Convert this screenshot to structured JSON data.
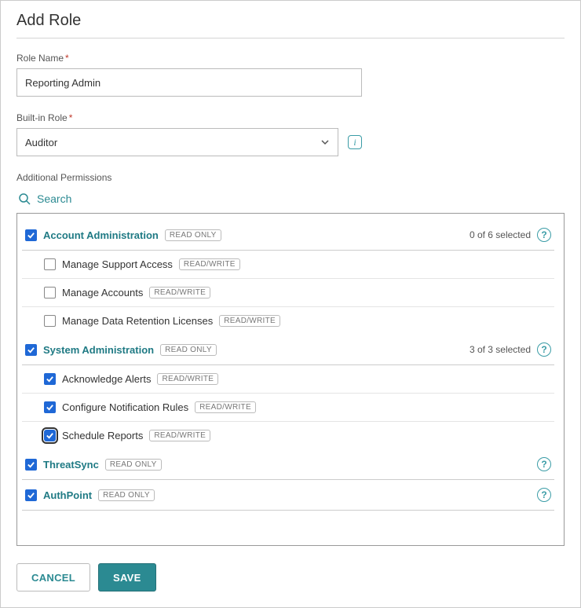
{
  "title": "Add Role",
  "roleName": {
    "label": "Role Name",
    "value": "Reporting Admin"
  },
  "builtInRole": {
    "label": "Built-in Role",
    "value": "Auditor"
  },
  "additionalPermissionsLabel": "Additional Permissions",
  "searchLabel": "Search",
  "badges": {
    "readOnly": "READ ONLY",
    "readWrite": "READ/WRITE"
  },
  "groups": [
    {
      "key": "account-admin",
      "title": "Account Administration",
      "checked": true,
      "selectedText": "0 of 6 selected",
      "items": [
        {
          "label": "Manage Support Access",
          "checked": false,
          "badge": "readWrite"
        },
        {
          "label": "Manage Accounts",
          "checked": false,
          "badge": "readWrite"
        },
        {
          "label": "Manage Data Retention Licenses",
          "checked": false,
          "badge": "readWrite"
        }
      ]
    },
    {
      "key": "system-admin",
      "title": "System Administration",
      "checked": true,
      "selectedText": "3 of 3 selected",
      "items": [
        {
          "label": "Acknowledge Alerts",
          "checked": true,
          "badge": "readWrite"
        },
        {
          "label": "Configure Notification Rules",
          "checked": true,
          "badge": "readWrite"
        },
        {
          "label": "Schedule Reports",
          "checked": true,
          "badge": "readWrite",
          "focused": true
        }
      ]
    },
    {
      "key": "threatsync",
      "title": "ThreatSync",
      "checked": true,
      "selectedText": "",
      "items": []
    },
    {
      "key": "authpoint",
      "title": "AuthPoint",
      "checked": true,
      "selectedText": "",
      "items": []
    }
  ],
  "footer": {
    "cancel": "CANCEL",
    "save": "SAVE"
  }
}
